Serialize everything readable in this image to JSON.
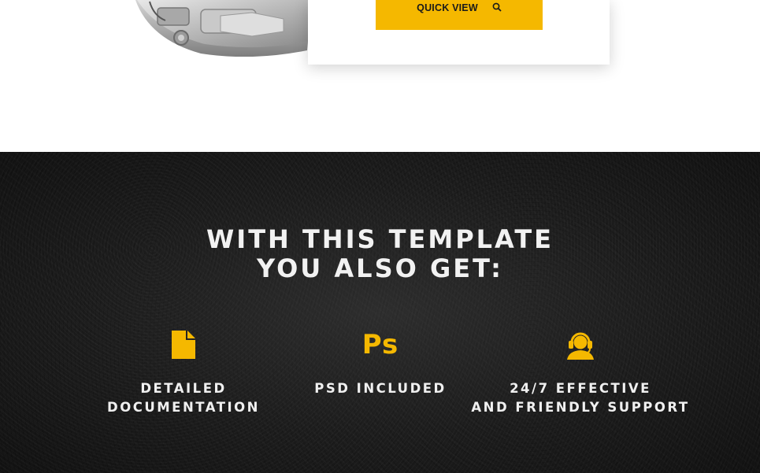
{
  "product": {
    "quick_view_label": "QUICK VIEW",
    "quick_view_icon": "search-icon"
  },
  "promo": {
    "title_line1": "WITH THIS TEMPLATE",
    "title_line2": "YOU ALSO GET:",
    "features": [
      {
        "icon": "document-icon",
        "line1": "DETAILED",
        "line2": "DOCUMENTATION"
      },
      {
        "icon": "photoshop-icon",
        "icon_text": "Ps",
        "line1": "PSD INCLUDED",
        "line2": ""
      },
      {
        "icon": "support-agent-icon",
        "line1": "24/7 EFFECTIVE",
        "line2": "AND FRIENDLY SUPPORT"
      }
    ]
  },
  "colors": {
    "accent": "#f5b800",
    "band_background": "#1c1c1c",
    "text_light": "#f0f0f0"
  }
}
